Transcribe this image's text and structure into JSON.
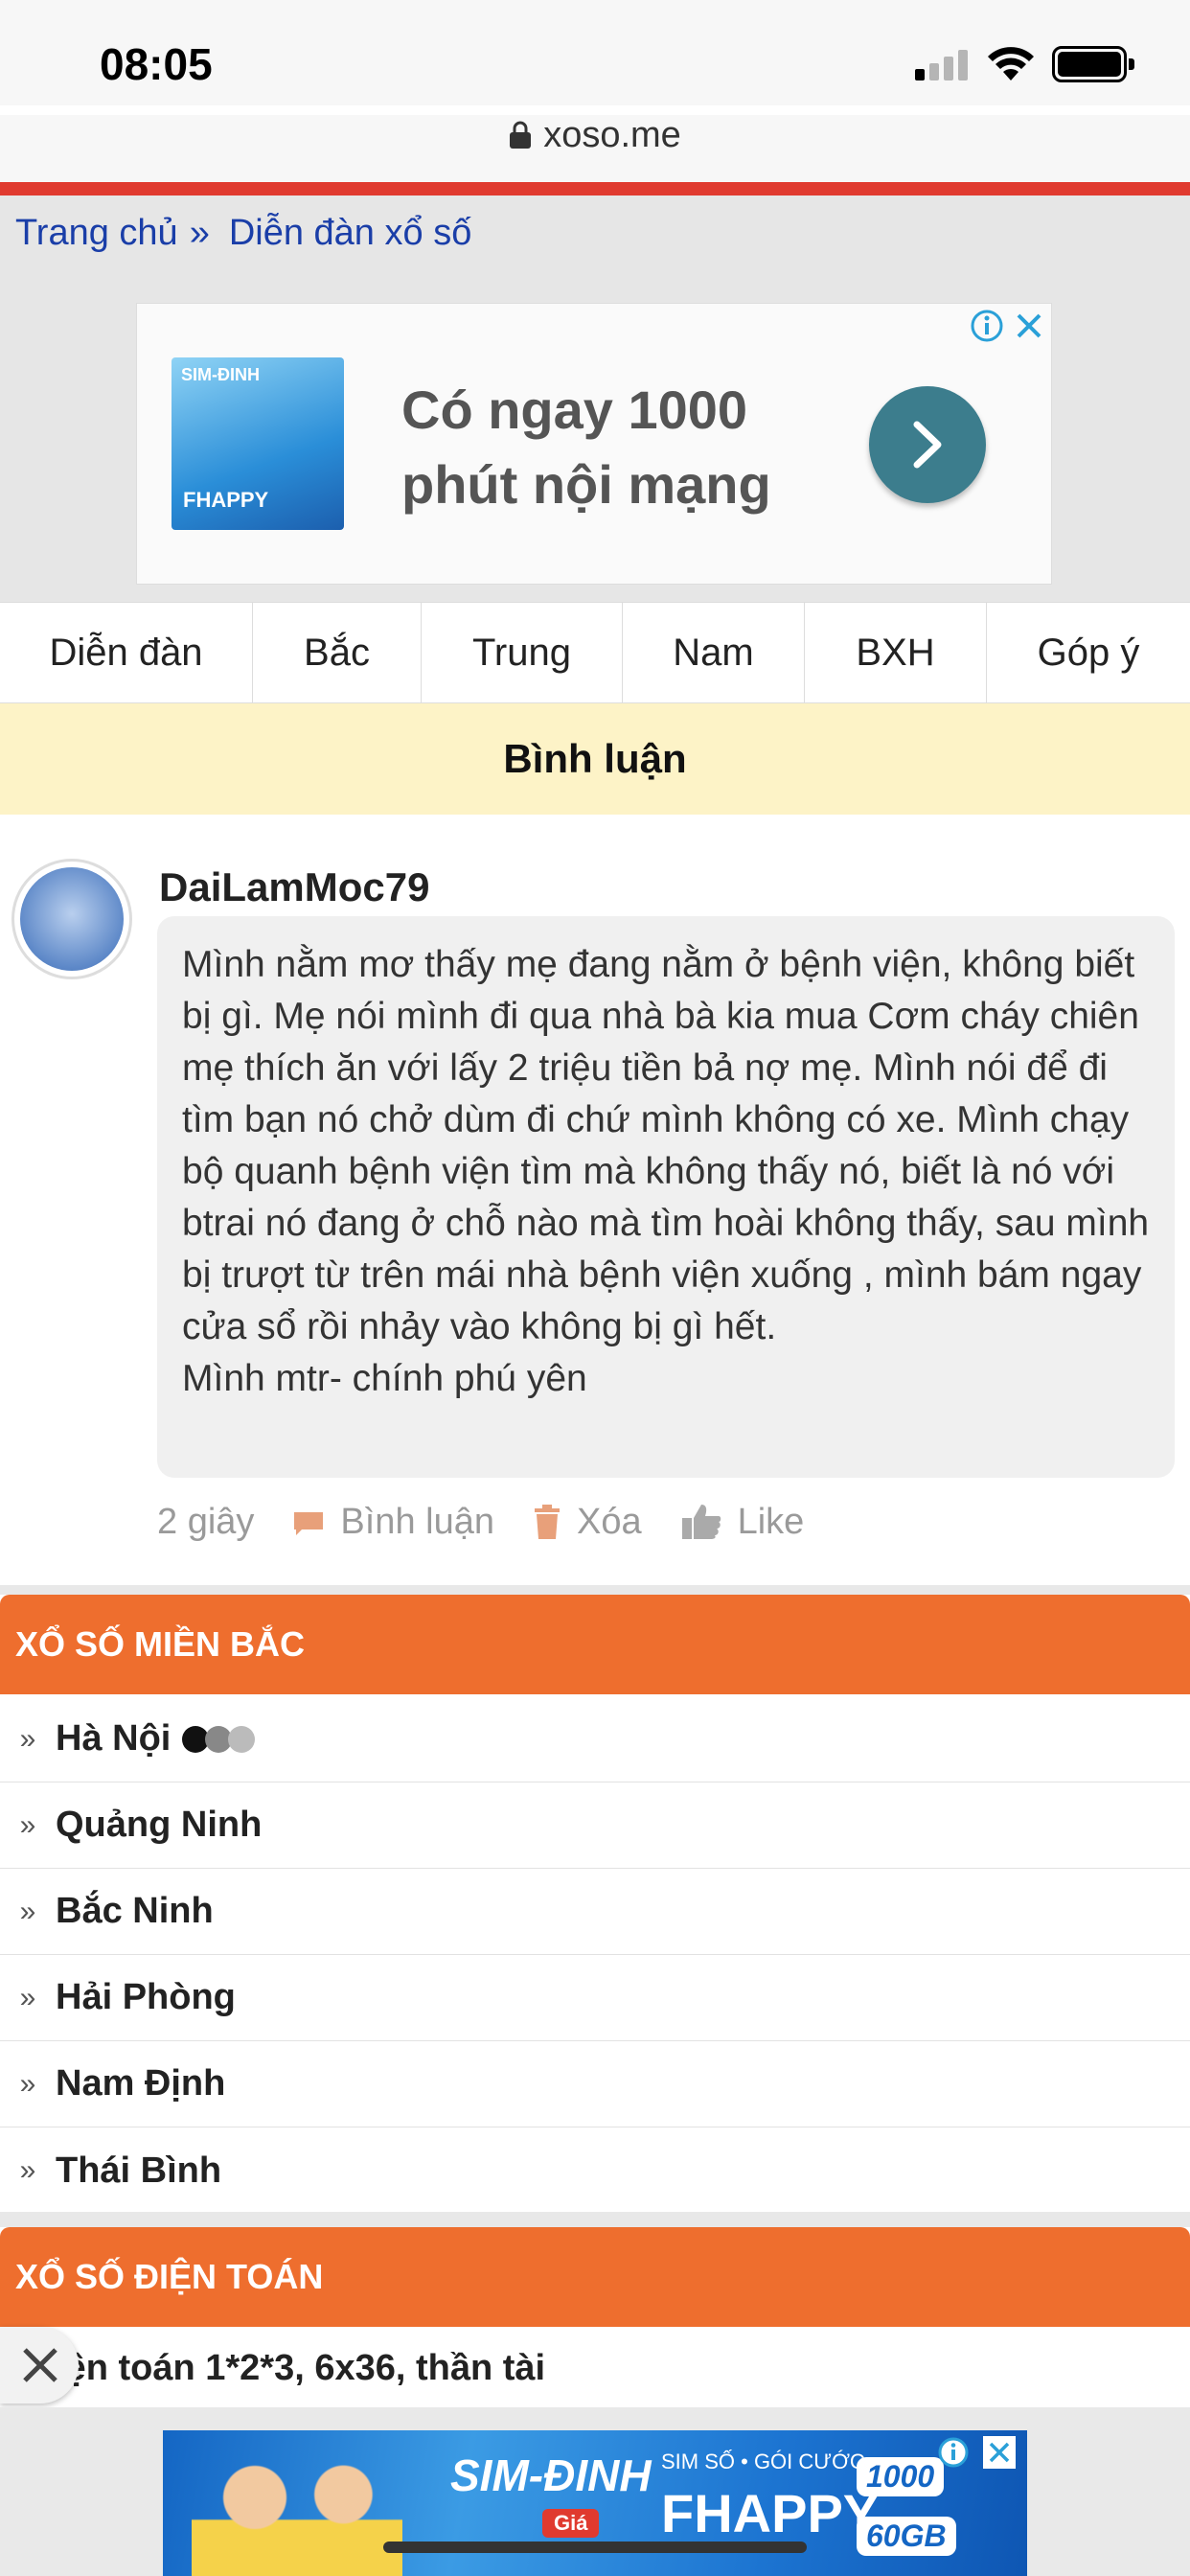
{
  "status_bar": {
    "time": "08:05"
  },
  "url_bar": {
    "domain": "xoso.me"
  },
  "breadcrumb": {
    "home": "Trang chủ",
    "separator": "»",
    "current": "Diễn đàn xổ số"
  },
  "ad_top": {
    "headline": "Có ngay 1000 phút nội mạng",
    "thumb_title": "SIM-ĐINH",
    "thumb_brand": "FHAPPY"
  },
  "nav": {
    "items": [
      "Diễn đàn",
      "Bắc",
      "Trung",
      "Nam",
      "BXH",
      "Góp ý"
    ]
  },
  "section": {
    "title": "Bình luận"
  },
  "comment": {
    "username": "DaiLamMoc79",
    "text": "Mình nằm mơ thấy mẹ đang nằm ở bệnh viện, không biết bị gì. Mẹ nói mình đi qua nhà bà kia mua Cơm cháy chiên mẹ thích ăn với lấy 2 triệu tiền bả nợ mẹ. Mình nói để đi tìm bạn nó chở dùm đi chứ mình không có xe. Mình chạy bộ quanh bệnh viện tìm mà không thấy nó, biết là nó với btrai nó đang ở chỗ nào mà tìm hoài không thấy, sau mình bị trượt từ trên mái nhà bệnh viện xuống , mình bám ngay cửa sổ rồi nhảy vào không bị gì hết.",
    "signature": "Mình mtr- chính phú yên",
    "time_ago": "2 giây",
    "reply_label": "Bình luận",
    "delete_label": "Xóa",
    "like_label": "Like"
  },
  "mien_bac": {
    "title": "XỔ SỐ MIỀN BẮC",
    "items": [
      "Hà Nội",
      "Quảng Ninh",
      "Bắc Ninh",
      "Hải Phòng",
      "Nam Định",
      "Thái Bình"
    ]
  },
  "dien_toan": {
    "title": "XỔ SỐ ĐIỆN TOÁN",
    "items": [
      "iện toán 1*2*3, 6x36, thần tài"
    ]
  },
  "ad_bottom": {
    "brand": "SIM-ĐINH",
    "tag": "Giá",
    "sub": "SIM SỐ • GÓI CƯỚC",
    "product": "FHAPPY",
    "badge1": "1000",
    "badge2": "60GB"
  },
  "colors": {
    "accent_red": "#e03a2f",
    "section_orange": "#ee6e2e",
    "link_blue": "#1a3ea8",
    "highlight_yellow": "#fdf3c7",
    "meta_icon": "#e8a07a"
  }
}
